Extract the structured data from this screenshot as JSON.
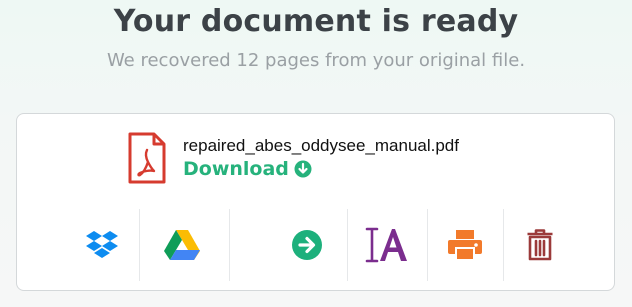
{
  "header": {
    "title": "Your document is ready",
    "subtitle": "We recovered 12 pages from your original file."
  },
  "file": {
    "name": "repaired_abes_oddysee_manual.pdf",
    "download_label": "Download",
    "icon": "pdf-file-icon"
  },
  "actions": [
    {
      "name": "dropbox",
      "icon": "dropbox-icon",
      "color": "#0d8cf0"
    },
    {
      "name": "google-drive",
      "icon": "google-drive-icon",
      "color": "#1fa463"
    },
    {
      "name": "next",
      "icon": "arrow-right-icon",
      "color": "#1db07c"
    },
    {
      "name": "ocr",
      "icon": "text-recognition-icon",
      "color": "#7b2d8e"
    },
    {
      "name": "print",
      "icon": "printer-icon",
      "color": "#f27a2b"
    },
    {
      "name": "delete",
      "icon": "trash-icon",
      "color": "#9b3a3a"
    }
  ],
  "colors": {
    "accent": "#26b27c",
    "pdf_red": "#d63b2f"
  }
}
